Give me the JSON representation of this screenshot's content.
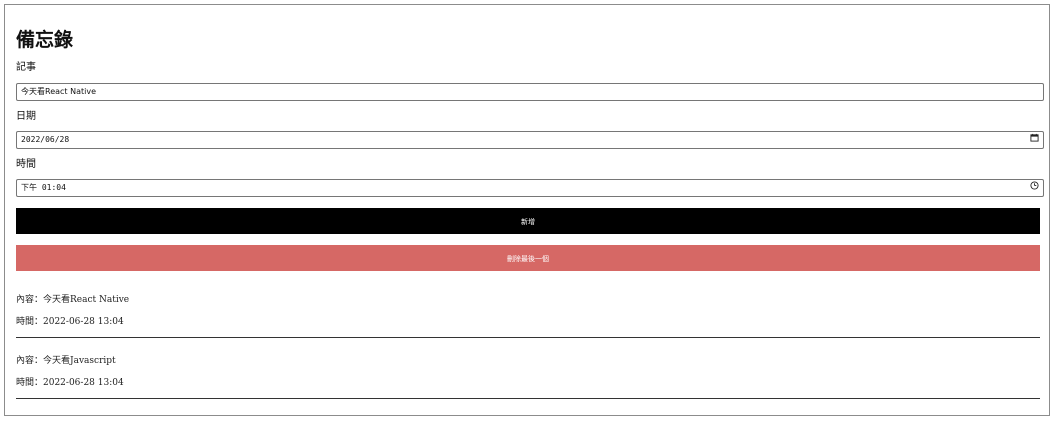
{
  "page": {
    "title": "備忘錄"
  },
  "form": {
    "note_label": "記事",
    "note_value": "今天看React Native",
    "date_label": "日期",
    "date_value": "2022/06/28",
    "time_label": "時間",
    "time_value": "下午 01:04",
    "add_button": "新增",
    "delete_button": "刪除最後一個"
  },
  "memos": [
    {
      "content": "內容：今天看React Native",
      "time": "時間：2022-06-28 13:04"
    },
    {
      "content": "內容：今天看Javascript",
      "time": "時間：2022-06-28 13:04"
    }
  ],
  "colors": {
    "add_button": "#000000",
    "delete_button": "#d66865"
  },
  "icons": {
    "date_field": "calendar-icon",
    "time_field": "clock-icon"
  }
}
